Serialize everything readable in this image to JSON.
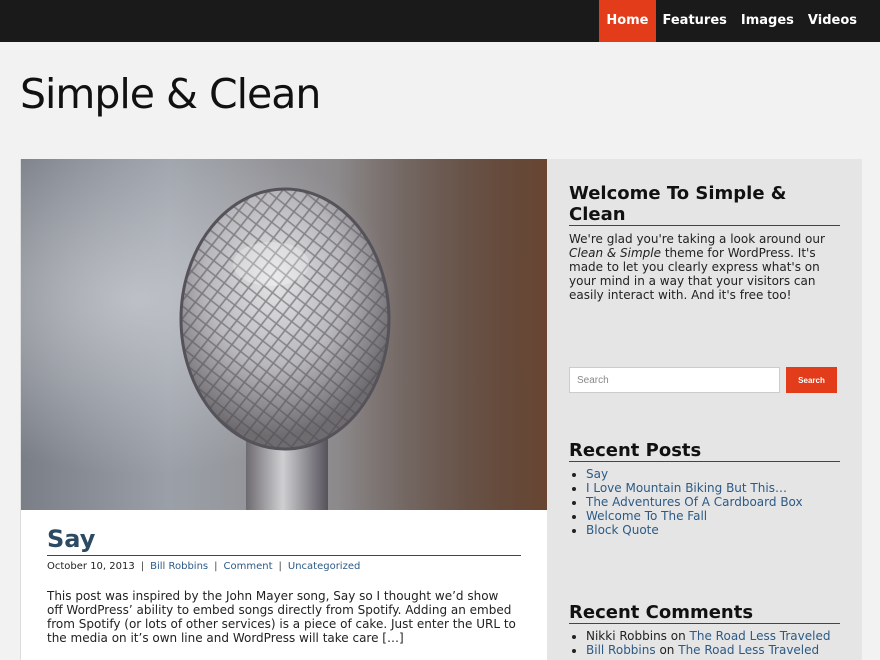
{
  "nav": {
    "items": [
      {
        "label": "Home",
        "active": true
      },
      {
        "label": "Features",
        "active": false
      },
      {
        "label": "Images",
        "active": false
      },
      {
        "label": "Videos",
        "active": false
      }
    ]
  },
  "site": {
    "title": "Simple & Clean"
  },
  "post": {
    "title": "Say",
    "date": "October 10, 2013",
    "author": "Bill Robbins",
    "comment_link": "Comment",
    "category": "Uncategorized",
    "excerpt": "This post was inspired by the John Mayer song, Say so I thought we’d show off WordPress’ ability to embed songs directly from Spotify.  Adding an embed from Spotify (or lots of other services) is a piece of cake.  Just enter the URL to the media on it’s own line and WordPress will take care […]"
  },
  "sidebar": {
    "welcome": {
      "title": "Welcome To Simple & Clean",
      "text_before": "We're glad you're taking a look around our ",
      "text_em": "Clean & Simple",
      "text_after": " theme for WordPress. It's made to let you clearly express what's on your mind in a way that your visitors can easily interact with. And it's free too!"
    },
    "search": {
      "placeholder": "Search",
      "button": "Search"
    },
    "recent_posts": {
      "title": "Recent Posts",
      "items": [
        "Say",
        "I Love Mountain Biking But This…",
        "The Adventures Of A Cardboard Box",
        "Welcome To The Fall",
        "Block Quote"
      ]
    },
    "recent_comments": {
      "title": "Recent Comments",
      "items": [
        {
          "author": "Nikki Robbins",
          "author_link": false,
          "on": "on",
          "post": "The Road Less Traveled"
        },
        {
          "author": "Bill Robbins",
          "author_link": true,
          "on": "on",
          "post": "The Road Less Traveled"
        }
      ]
    }
  },
  "colors": {
    "accent": "#e23c1a",
    "topbar": "#1a1a1a",
    "link": "#2c5a85",
    "post_title": "#2c4a63"
  },
  "icons": {
    "hero_image": "microphone-photo"
  }
}
